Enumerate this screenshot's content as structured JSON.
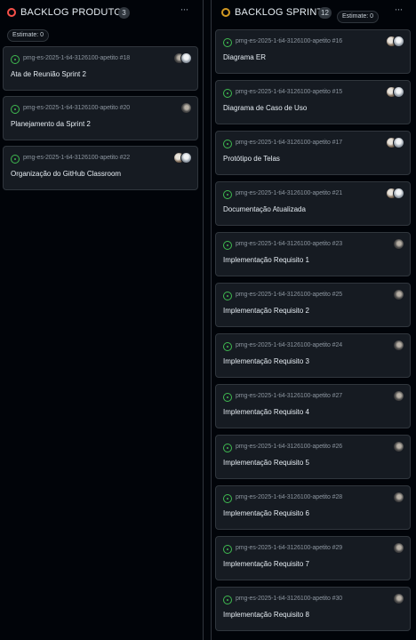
{
  "columns": [
    {
      "title": "BACKLOG PRODUTO",
      "count": "3",
      "estimate": "Estimate: 0",
      "status_color": "#f85149",
      "cards": [
        {
          "ref": "pmg-es-2025-1-ti4-3126100-apetito #18",
          "title": "Ata de Reunião Sprint 2",
          "avatars": [
            "avatar-b",
            "avatar-c"
          ]
        },
        {
          "ref": "pmg-es-2025-1-ti4-3126100-apetito #20",
          "title": "Planejamento da Sprint 2",
          "avatars": [
            "avatar-b"
          ]
        },
        {
          "ref": "pmg-es-2025-1-ti4-3126100-apetito #22",
          "title": "Organização do GitHub Classroom",
          "avatars": [
            "avatar-a",
            "avatar-c"
          ]
        }
      ]
    },
    {
      "title": "BACKLOG SPRINT",
      "count": "12",
      "estimate": "Estimate: 0",
      "status_color": "#d29922",
      "cards": [
        {
          "ref": "pmg-es-2025-1-ti4-3126100-apetito #16",
          "title": "Diagrama ER",
          "avatars": [
            "avatar-a",
            "avatar-c"
          ]
        },
        {
          "ref": "pmg-es-2025-1-ti4-3126100-apetito #15",
          "title": "Diagrama de Caso de Uso",
          "avatars": [
            "avatar-a",
            "avatar-c"
          ]
        },
        {
          "ref": "pmg-es-2025-1-ti4-3126100-apetito #17",
          "title": "Protótipo de Telas",
          "avatars": [
            "avatar-a",
            "avatar-c"
          ]
        },
        {
          "ref": "pmg-es-2025-1-ti4-3126100-apetito #21",
          "title": "Documentação Atualizada",
          "avatars": [
            "avatar-a",
            "avatar-c"
          ]
        },
        {
          "ref": "pmg-es-2025-1-ti4-3126100-apetito #23",
          "title": "Implementação Requisito 1",
          "avatars": [
            "avatar-b"
          ]
        },
        {
          "ref": "pmg-es-2025-1-ti4-3126100-apetito #25",
          "title": "Implementação Requisito 2",
          "avatars": [
            "avatar-b"
          ]
        },
        {
          "ref": "pmg-es-2025-1-ti4-3126100-apetito #24",
          "title": "Implementação Requisito 3",
          "avatars": [
            "avatar-b"
          ]
        },
        {
          "ref": "pmg-es-2025-1-ti4-3126100-apetito #27",
          "title": "Implementação Requisito 4",
          "avatars": [
            "avatar-b"
          ]
        },
        {
          "ref": "pmg-es-2025-1-ti4-3126100-apetito #26",
          "title": "Implementação Requisito 5",
          "avatars": [
            "avatar-b"
          ]
        },
        {
          "ref": "pmg-es-2025-1-ti4-3126100-apetito #28",
          "title": "Implementação Requisito 6",
          "avatars": [
            "avatar-b"
          ]
        },
        {
          "ref": "pmg-es-2025-1-ti4-3126100-apetito #29",
          "title": "Implementação Requisito 7",
          "avatars": [
            "avatar-b"
          ]
        },
        {
          "ref": "pmg-es-2025-1-ti4-3126100-apetito #30",
          "title": "Implementação Requisito 8",
          "avatars": [
            "avatar-b"
          ]
        }
      ]
    }
  ],
  "icons": {
    "status": "circle-status-icon",
    "more": "ellipsis-icon",
    "issue": "issue-open-icon",
    "more_glyph": "···"
  }
}
